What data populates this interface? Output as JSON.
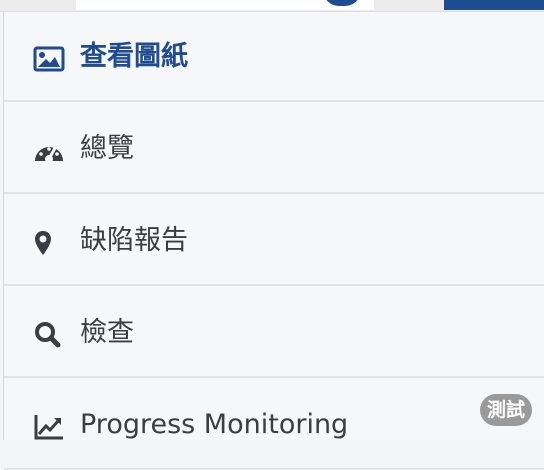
{
  "nav": {
    "items": [
      {
        "label": "查看圖紙",
        "icon": "image-icon",
        "active": true
      },
      {
        "label": "總覽",
        "icon": "dashboard-gauge-icon",
        "active": false
      },
      {
        "label": "缺陷報告",
        "icon": "map-marker-icon",
        "active": false
      },
      {
        "label": "檢查",
        "icon": "search-icon",
        "active": false
      },
      {
        "label": "Progress Monitoring",
        "icon": "line-chart-icon",
        "active": false
      }
    ],
    "badge": "測試"
  },
  "colors": {
    "accent": "#1f4b93",
    "text": "#3a3d42",
    "background": "#f6f7f8",
    "badge": "#9a9a9a"
  }
}
